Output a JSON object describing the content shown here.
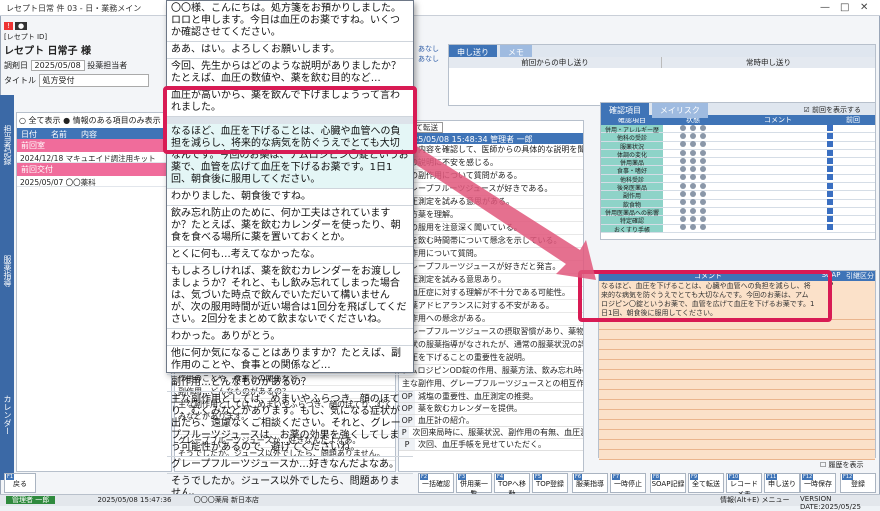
{
  "window": {
    "title": "レセプト日常 件 03 - 日・業務メイン",
    "controls": [
      "—",
      "□",
      "✕"
    ]
  },
  "patient": {
    "id_label": "[レセプト ID]",
    "name": "レセプト 日常子 様",
    "id_field": "調剤日",
    "date": "2025/05/08",
    "assign_label": "投薬担当者",
    "title_label": "タイトル",
    "title_value": "処方受付"
  },
  "filter": {
    "opt_all": "全て表示",
    "opt_info": "情報のある項目のみ表示"
  },
  "list": {
    "col_date": "日付",
    "col_name": "名前",
    "col_content": "内容",
    "group1": "前回室",
    "group2": "前回交付",
    "row1_date": "2024/12/18",
    "row1_text": "マキュエイド調注用キット",
    "row2_date": "2025/05/07",
    "row2_text": "〇〇薬科"
  },
  "left_tabs": [
    "担当者記録",
    "服薬指導",
    "カレンダー"
  ],
  "popup": {
    "messages": [
      "〇〇様、こんにちは。処方箋をお預かりしました。ロロと申します。今日は血圧のお薬ですね。いくつか確認させてください。",
      "ああ、はい。よろしくお願いします。",
      "今回、先生からはどのような説明がありましたか？たとえば、血圧の数値や、薬を飲む目的など…",
      "血圧が高いから、薬を飲んで下げましょうって言われました。",
      "なるほど、血圧を下げることは、心臓や血管への負担を減らし、将来的な病気を防ぐうえでとても大切なんです。今回のお薬は、アムロジピン〇錠というお薬で、血管を広げて血圧を下げるお薬です。1日1回、朝食後に服用してください。",
      "わかりました、朝食後ですね。",
      "飲み忘れ防止のために、何か工夫はされていますか？たとえば、薬を飲むカレンダーを使ったり、朝食を食べる場所に薬を置いておくとか。",
      "とくに何も…考えてなかったな。",
      "もしよろしければ、薬を飲むカレンダーをお渡ししましょうか？それと、もし飲み忘れてしまった場合は、気づいた時点で飲んでいただいて構いませんが、次の服用時間が近い場合は1回分を飛ばしてください。2回分をまとめて飲まないでくださいね。",
      "わかった。ありがとう。",
      "他に何か気になることはありますか？たとえば、副作用のことや、食事との関係など…",
      "副作用…どんなものがあるの？",
      "主な副作用としては、めまいやふらつき、顔のほてり、むくみなどがあります。もし、気になる症状が出たら、遠慮なくご相談ください。それと、グレープフルーツジュースは、お薬の効果を強くしてしまう可能性があるので、避けてくださいね。",
      "グレープフルーツジュースか…好きなんだよなあ。",
      "そうでしたか。ジュース以外でしたら、問題ありません。"
    ]
  },
  "middle": {
    "btn_all": "全て転送",
    "header_date": "2025/05/08 15:48:34 管理者 一郎",
    "items": [
      "処方内容を確認して、医師からの具体的な説明を聞いた。",
      "飲の説明に不安を感じる。",
      "薬の副作用について質問がある。",
      "グレープフルーツジュースが好きである。",
      "血圧測定を試みる意思がある。",
      "処方薬を理解。",
      "薬の服用を注意深く聞いている。",
      "薬を飲む時間帯について懸念を示している。",
      "副作用について質問。",
      "グレープフルーツジュースが好きだと発言。",
      "血圧測定を試みる意思あり。",
      "高血圧症に対する理解が不十分である可能性。",
      "服薬アドヒアランスに対する不安がある。",
      "副作用への懸念がある。",
      "グレープフルーツジュースの摂取習慣があり、薬物相互作用のリスクがある。",
      "現状の服薬指導がなされたが、通常の服薬状況の詳細は不明である。",
      "血圧を下げることの重要性を説明。",
      "アムロジピンOD錠の作用、服薬方法、飲み忘れ時の対応について説明。",
      "主な副作用、グレープフルーツジュースとの相互作用について説明。"
    ],
    "op_items": [
      {
        "tag": "OP",
        "text": "減塩の重要性、血圧測定の推奨。"
      },
      {
        "tag": "OP",
        "text": "薬を飲むカレンダーを提供。"
      },
      {
        "tag": "OP",
        "text": "血圧計の紹介。"
      },
      {
        "tag": "P",
        "text": "次回来局時に、服薬状況、副作用の有無、血圧測定の結果について確認。"
      },
      {
        "tag": "P",
        "text": "次回、血圧手帳を見せていただく。"
      }
    ]
  },
  "left_dup": [
    "作用のことや、食事との関係など…",
    "副作用…どんなものがあるの？",
    "主な副作用としては、めまいやふらつき、顔のほてり、むくみなどがあります。",
    "グレープフルーツジュースか…好きなんだよなあ。",
    "そうでしたか。ジュース以外でしたら、問題ありません。"
  ],
  "handover": {
    "tab1": "申し送り",
    "tab2": "メモ",
    "col_prev": "前回からの申し送り",
    "col_always": "常時申し送り",
    "side1": "あなし",
    "side2": "あなし"
  },
  "checks": {
    "tab1": "確認項目",
    "tab2": "メイリスク",
    "show_prev": "前回を表示する",
    "col_item": "確認項目",
    "col_check": "状態",
    "col_comment": "コメント",
    "col_prev": "前回",
    "items": [
      "併用・アレルギー歴",
      "他科の受診",
      "服薬状況",
      "体調の変化",
      "併用薬品",
      "食事・嗜好",
      "他科受診",
      "後発医薬品",
      "副作用",
      "飲食物",
      "併用医薬品への影響",
      "特定確認",
      "おくすり手帳"
    ]
  },
  "comment": {
    "col_comment": "コメント",
    "col_flag": "SOAP",
    "col_src": "引継区分",
    "text": "なるほど、血圧を下げることは、心臓や血管への負担を減らし、将来的な病気を防ぐうえでとても大切なんです。今回のお薬は、アムロジピン〇錠というお薬で、血管を広げて血圧を下げるお薬です。1日1回、朝食後に服用してください。",
    "flag": "P",
    "show_history": "履歴を表示"
  },
  "fkeys": [
    {
      "key": "F1",
      "label": "戻る"
    },
    {
      "key": "F2",
      "label": "一括確認"
    },
    {
      "key": "F3",
      "label": "併用薬一覧"
    },
    {
      "key": "F4",
      "label": "TOPへ移動"
    },
    {
      "key": "F5",
      "label": "TOP登録"
    },
    {
      "key": "F6",
      "label": "服薬指導"
    },
    {
      "key": "F7",
      "label": "一時停止"
    },
    {
      "key": "F8",
      "label": "SOAP記録"
    },
    {
      "key": "F9",
      "label": "全て転送"
    },
    {
      "key": "F10",
      "label": "レコードメモ"
    },
    {
      "key": "F11",
      "label": "申し送り"
    },
    {
      "key": "F12",
      "label": "一時保存"
    },
    {
      "key": "F12",
      "label": "登録"
    }
  ],
  "status": {
    "user": "管理者 一郎",
    "datetime": "2025/05/08 15:47:36",
    "pharmacy": "〇〇〇薬局 新日本店",
    "info": "情報(Alt+E) メニュー",
    "version": "VERSION DATE:2025/05/25"
  }
}
